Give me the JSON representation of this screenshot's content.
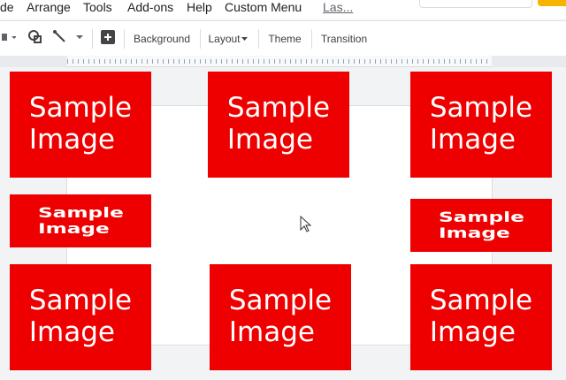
{
  "menu": {
    "items": [
      "de",
      "Arrange",
      "Tools",
      "Add-ons",
      "Help",
      "Custom Menu"
    ],
    "last_edit": "Las..."
  },
  "toolbar": {
    "background": "Background",
    "layout": "Layout",
    "theme": "Theme",
    "transition": "Transition"
  },
  "slide": {
    "images": [
      {
        "text": "Sample\nImage"
      },
      {
        "text": "Sample\nImage"
      },
      {
        "text": "Sample\nImage"
      },
      {
        "text": "Sample\nImage"
      },
      {
        "text": "Sample\nImage"
      },
      {
        "text": "Sample\nImage"
      },
      {
        "text": "Sample\nImage"
      },
      {
        "text": "Sample\nImage"
      }
    ]
  },
  "colors": {
    "image_fill": "#ee0000",
    "share_button": "#f4b400",
    "slide_background": "#ffffff",
    "workspace": "#f1f3f4"
  }
}
